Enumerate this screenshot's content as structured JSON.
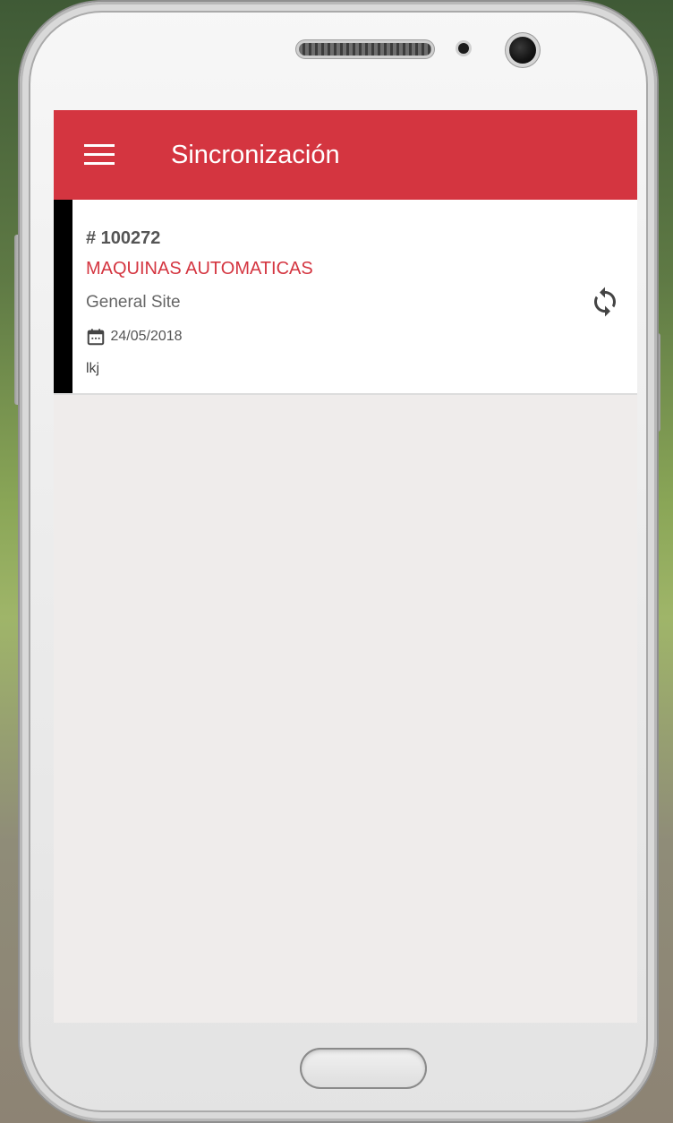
{
  "app_bar": {
    "title": "Sincronización",
    "menu_icon": "hamburger-menu-icon",
    "background_color": "#d43540"
  },
  "records": [
    {
      "number": "# 100272",
      "machine": "MAQUINAS AUTOMATICAS",
      "site": "General Site",
      "date": "24/05/2018",
      "note": "lkj",
      "date_icon": "calendar-icon",
      "action_icon": "sync-icon"
    }
  ],
  "colors": {
    "accent": "#d43540",
    "card_stripe": "#000000",
    "screen_background": "#efeceb"
  }
}
